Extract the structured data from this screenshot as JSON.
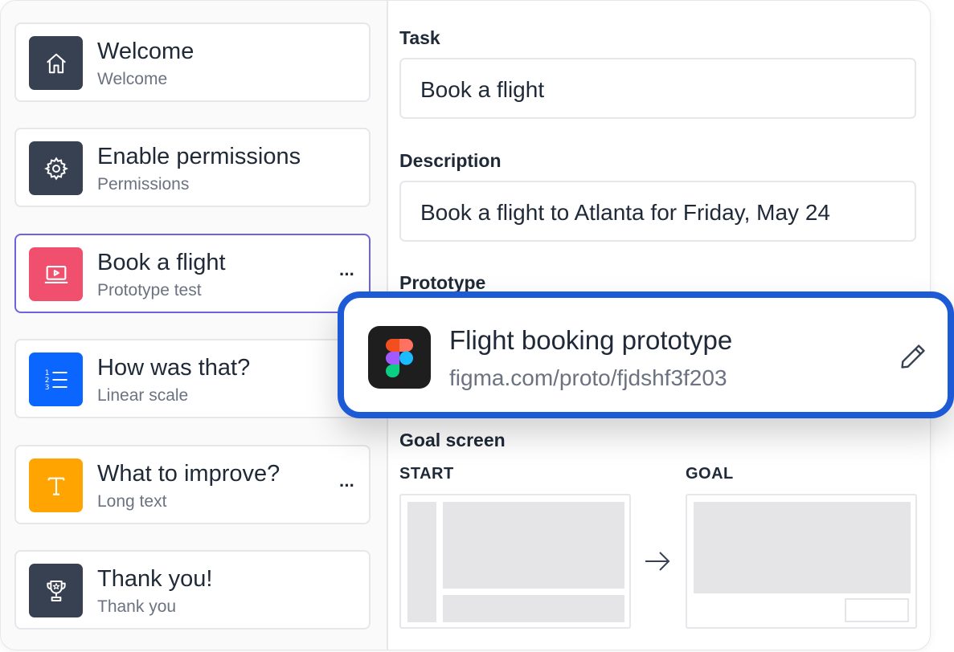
{
  "steps": [
    {
      "title": "Welcome",
      "subtitle": "Welcome",
      "icon": "home-icon",
      "color": "#374151"
    },
    {
      "title": "Enable permissions",
      "subtitle": "Permissions",
      "icon": "gear-icon",
      "color": "#374151"
    },
    {
      "title": "Book a flight",
      "subtitle": "Prototype test",
      "icon": "laptop-play-icon",
      "color": "#f0506e",
      "active": true,
      "more": "···"
    },
    {
      "title": "How was that?",
      "subtitle": "Linear scale",
      "icon": "numbered-list-icon",
      "color": "#0a66ff"
    },
    {
      "title": "What to improve?",
      "subtitle": "Long text",
      "icon": "text-icon",
      "color": "#ffa400",
      "more": "···"
    },
    {
      "title": "Thank you!",
      "subtitle": "Thank you",
      "icon": "trophy-icon",
      "color": "#374151"
    }
  ],
  "task": {
    "label": "Task",
    "value": "Book a flight"
  },
  "description": {
    "label": "Description",
    "value": "Book a flight to Atlanta for Friday, May 24"
  },
  "prototype": {
    "label": "Prototype",
    "name": "Flight booking prototype",
    "url": "figma.com/proto/fjdshf3f203",
    "icon": "figma-icon",
    "action_icon": "pencil-icon"
  },
  "goal_screen": {
    "label": "Goal screen",
    "start_label": "START",
    "goal_label": "GOAL",
    "arrow_icon": "arrow-right-icon"
  },
  "colors": {
    "accent": "#1d5bd6",
    "active_border": "#6b63e0"
  }
}
